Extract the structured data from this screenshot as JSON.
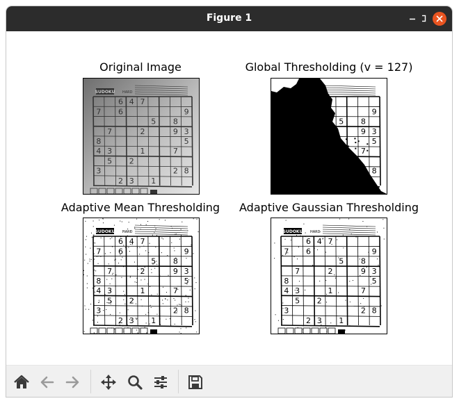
{
  "window": {
    "title": "Figure 1"
  },
  "panels": [
    {
      "title": "Original Image"
    },
    {
      "title": "Global Thresholding (v = 127)"
    },
    {
      "title": "Adaptive Mean Thresholding"
    },
    {
      "title": "Adaptive Gaussian Thresholding"
    }
  ],
  "sudoku": {
    "header": "SUDOKU",
    "level": "HARD",
    "rows": [
      [
        "",
        "",
        "6",
        "4",
        "7",
        "",
        "",
        "",
        ""
      ],
      [
        "7",
        "",
        "6",
        "",
        "",
        "",
        "",
        "",
        "9"
      ],
      [
        "",
        "",
        "",
        "",
        "",
        "5",
        "",
        "8",
        ""
      ],
      [
        "",
        "7",
        "",
        "",
        "2",
        "",
        "",
        "9",
        "3"
      ],
      [
        "8",
        "",
        "",
        "",
        "",
        "",
        "",
        "",
        "5"
      ],
      [
        "4",
        "3",
        "",
        "",
        "1",
        "",
        "",
        "7",
        ""
      ],
      [
        "",
        "5",
        "",
        "2",
        "",
        "",
        "",
        "",
        ""
      ],
      [
        "3",
        "",
        "",
        "",
        "",
        "",
        "",
        "2",
        "8"
      ],
      [
        "",
        "",
        "2",
        "3",
        "",
        "1",
        "",
        "",
        ""
      ]
    ]
  },
  "toolbar": {
    "icons": [
      "home-icon",
      "back-icon",
      "forward-icon",
      "pan-icon",
      "zoom-icon",
      "configure-icon",
      "save-icon"
    ]
  },
  "colors": {
    "titlebar": "#2c2c2c",
    "close": "#e95420",
    "toolbar": "#f0f0f0"
  }
}
